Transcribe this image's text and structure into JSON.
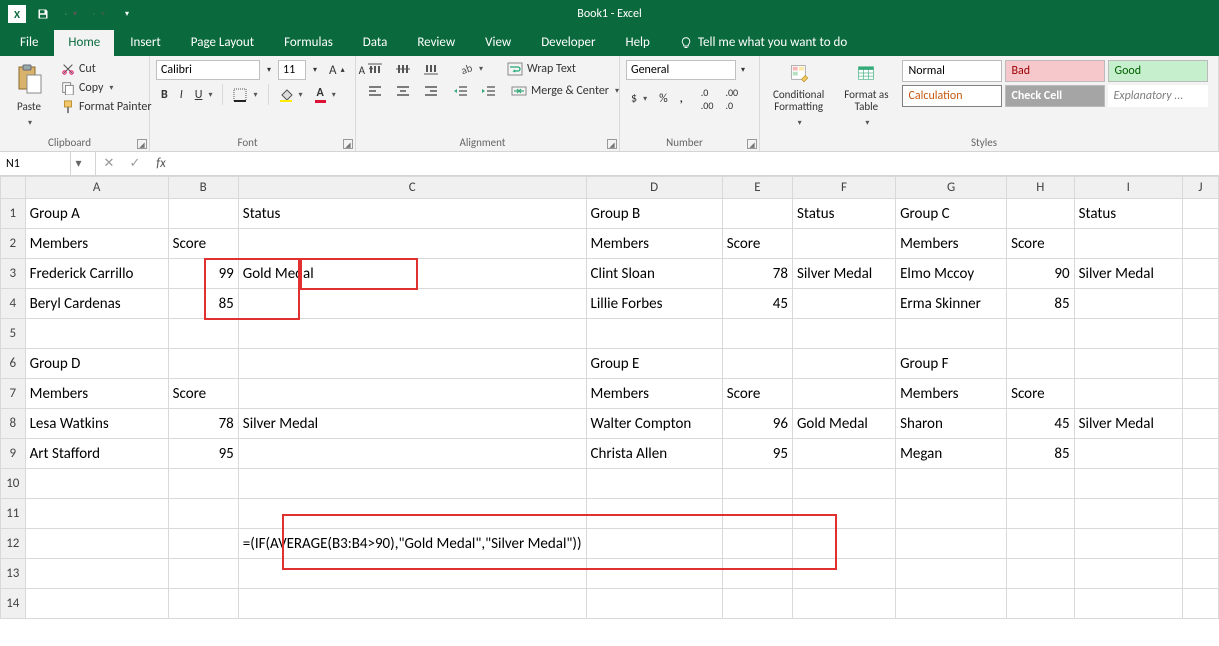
{
  "title": "Book1 - Excel",
  "tabs": [
    "File",
    "Home",
    "Insert",
    "Page Layout",
    "Formulas",
    "Data",
    "Review",
    "View",
    "Developer",
    "Help"
  ],
  "tellme": "Tell me what you want to do",
  "clipboard": {
    "cut": "Cut",
    "copy": "Copy",
    "paint": "Format Painter",
    "paste": "Paste",
    "label": "Clipboard"
  },
  "font": {
    "name": "Calibri",
    "size": "11",
    "label": "Font"
  },
  "alignment": {
    "wrap": "Wrap Text",
    "merge": "Merge & Center",
    "label": "Alignment"
  },
  "number": {
    "format": "General",
    "label": "Number"
  },
  "styles": {
    "cond": "Conditional\nFormatting",
    "table": "Format as\nTable",
    "normal": "Normal",
    "bad": "Bad",
    "good": "Good",
    "calc": "Calculation",
    "check": "Check Cell",
    "expl": "Explanatory ...",
    "label": "Styles"
  },
  "namebox": "N1",
  "formula": "",
  "columns": [
    "A",
    "B",
    "C",
    "D",
    "E",
    "F",
    "G",
    "H",
    "I",
    "J"
  ],
  "cells": {
    "A1": "Group A",
    "C1": "Status",
    "D1": "Group B",
    "F1": "Status",
    "G1": "Group C",
    "I1": "Status",
    "A2": "Members",
    "B2": "Score",
    "D2": "Members",
    "E2": "Score",
    "G2": "Members",
    "H2": "Score",
    "A3": "Frederick Carrillo",
    "B3": "99",
    "C3": "Gold Medal",
    "D3": "Clint Sloan",
    "E3": "78",
    "F3": "Silver Medal",
    "G3": "Elmo Mccoy",
    "H3": "90",
    "I3": "Silver Medal",
    "A4": "Beryl Cardenas",
    "B4": "85",
    "D4": "Lillie Forbes",
    "E4": "45",
    "G4": "Erma Skinner",
    "H4": "85",
    "A6": "Group D",
    "D6": "Group E",
    "G6": "Group F",
    "A7": "Members",
    "B7": "Score",
    "D7": "Members",
    "E7": "Score",
    "G7": "Members",
    "H7": "Score",
    "A8": "Lesa Watkins",
    "B8": "78",
    "C8": "Silver Medal",
    "D8": "Walter Compton",
    "E8": "96",
    "F8": "Gold Medal",
    "G8": "Sharon",
    "H8": "45",
    "I8": "Silver Medal",
    "A9": "Art Stafford",
    "B9": "95",
    "D9": "Christa Allen",
    "E9": "95",
    "G9": "Megan",
    "H9": "85",
    "C12": "=(IF(AVERAGE(B3:B4>90),\"Gold Medal\",\"Silver Medal\"))"
  }
}
